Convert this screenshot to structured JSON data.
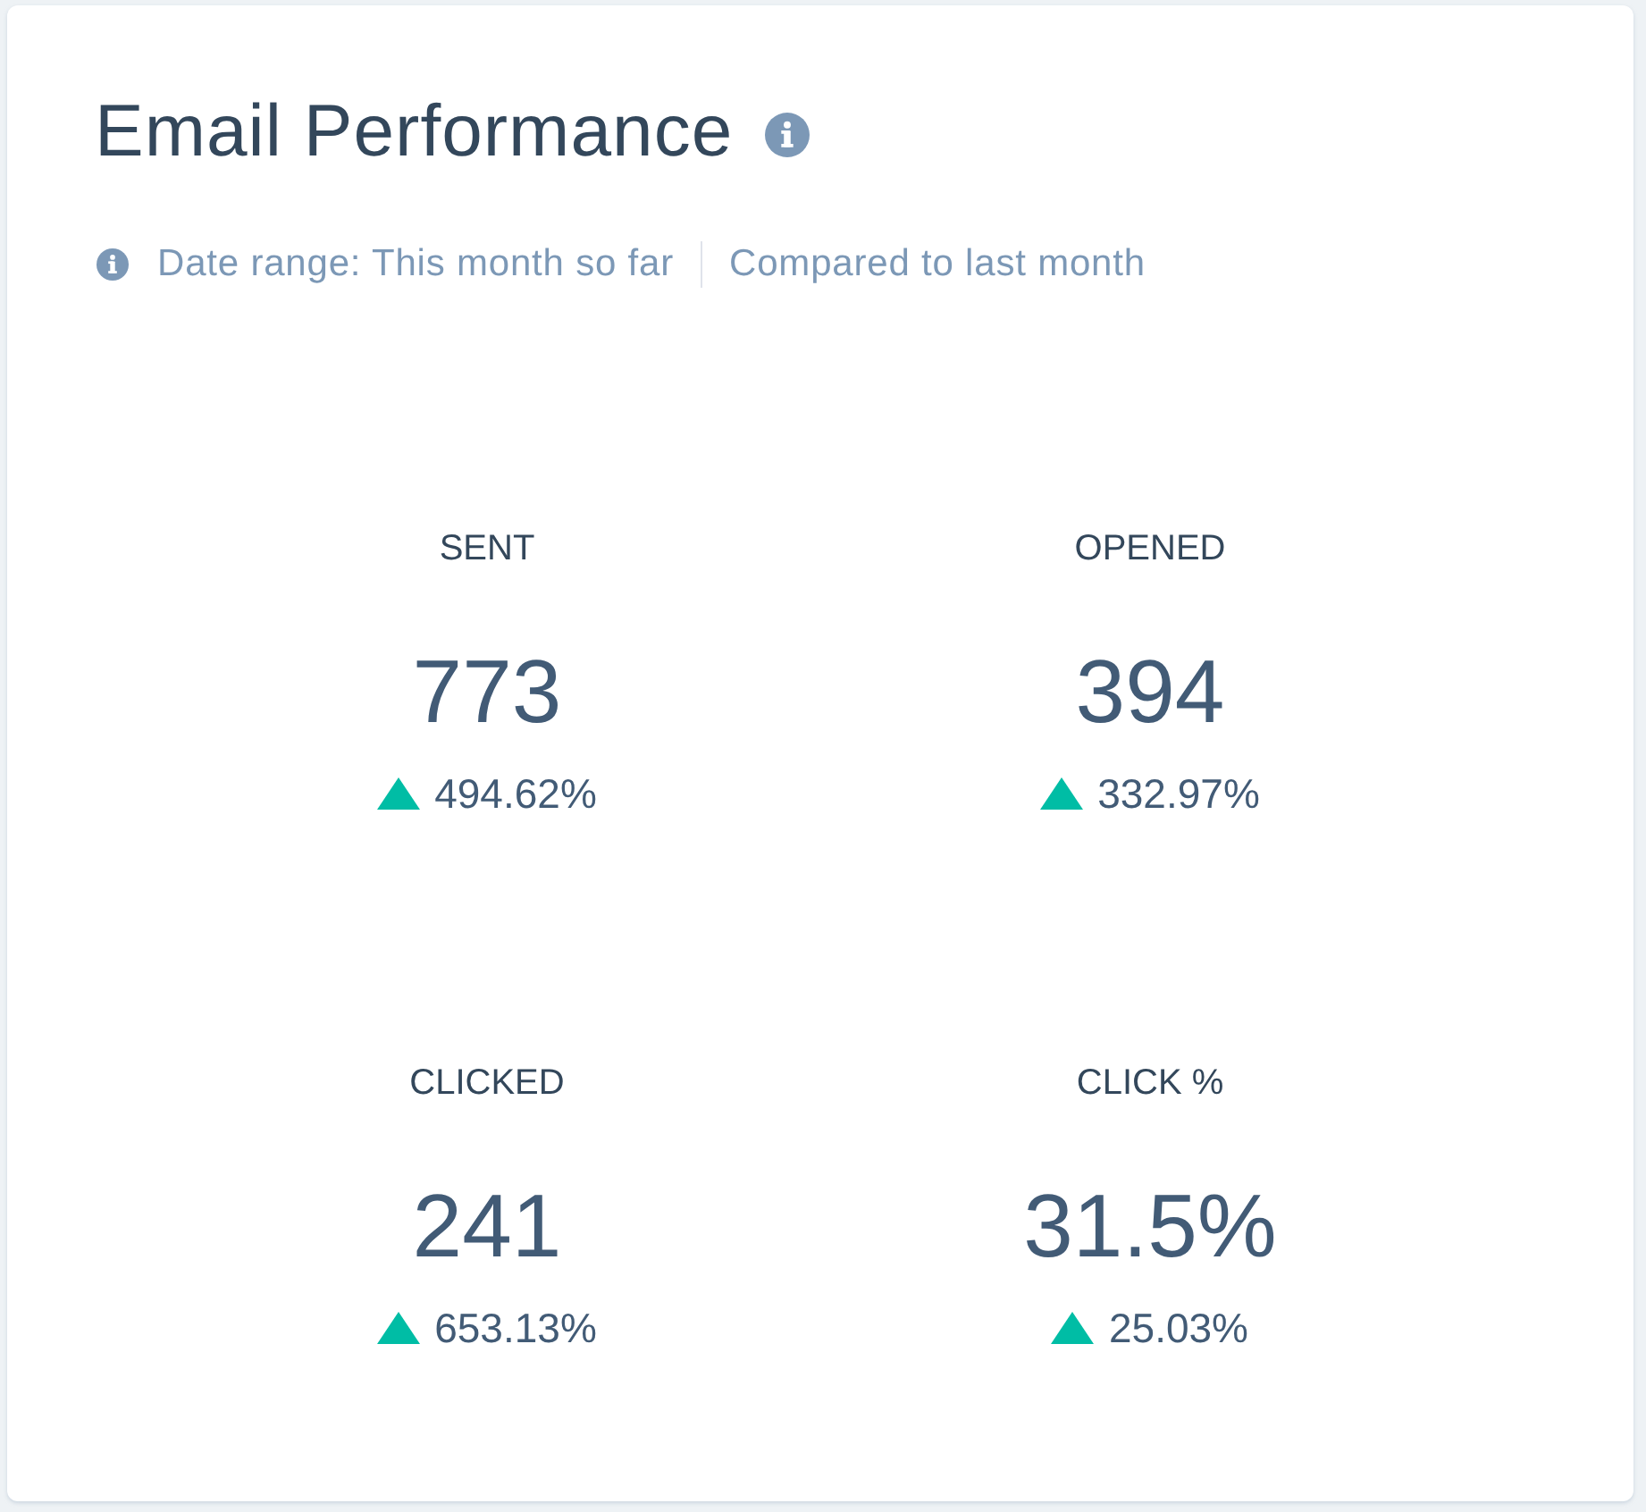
{
  "card": {
    "title": "Email Performance",
    "date_range": "Date range: This month so far",
    "comparison": "Compared to last month"
  },
  "stats": [
    {
      "label": "SENT",
      "value": "773",
      "change": "494.62%",
      "increase": true
    },
    {
      "label": "OPENED",
      "value": "394",
      "change": "332.97%",
      "increase": true
    },
    {
      "label": "CLICKED",
      "value": "241",
      "change": "653.13%",
      "increase": true
    },
    {
      "label": "CLICK %",
      "value": "31.5%",
      "change": "25.03%",
      "increase": true
    }
  ]
}
